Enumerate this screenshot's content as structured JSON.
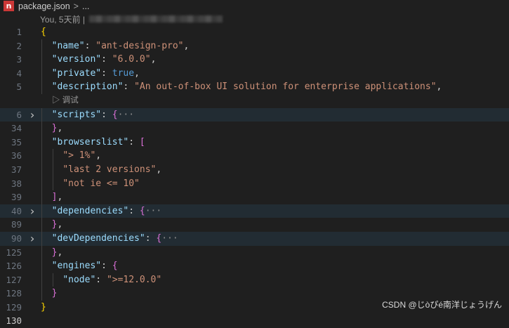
{
  "breadcrumb": {
    "icon": "npm-icon",
    "icon_letter": "n",
    "file": "package.json",
    "separator": ">",
    "more": "..."
  },
  "blame": {
    "text": "You, 5天前 |"
  },
  "codelens": {
    "label": "▷ 调试"
  },
  "lines": [
    {
      "n": "1",
      "tokens": [
        {
          "c": "b1",
          "t": "{"
        }
      ]
    },
    {
      "n": "2",
      "tokens": [
        {
          "c": "k",
          "t": "\"name\""
        },
        {
          "c": "p",
          "t": ": "
        },
        {
          "c": "s",
          "t": "\"ant-design-pro\""
        },
        {
          "c": "p",
          "t": ","
        }
      ]
    },
    {
      "n": "3",
      "tokens": [
        {
          "c": "k",
          "t": "\"version\""
        },
        {
          "c": "p",
          "t": ": "
        },
        {
          "c": "s",
          "t": "\"6.0.0\""
        },
        {
          "c": "p",
          "t": ","
        }
      ]
    },
    {
      "n": "4",
      "tokens": [
        {
          "c": "k",
          "t": "\"private\""
        },
        {
          "c": "p",
          "t": ": "
        },
        {
          "c": "kw",
          "t": "true"
        },
        {
          "c": "p",
          "t": ","
        }
      ]
    },
    {
      "n": "5",
      "tokens": [
        {
          "c": "k",
          "t": "\"description\""
        },
        {
          "c": "p",
          "t": ": "
        },
        {
          "c": "s",
          "t": "\"An out-of-box UI solution for enterprise applications\""
        },
        {
          "c": "p",
          "t": ","
        }
      ]
    },
    {
      "n": "",
      "codelens": true
    },
    {
      "n": "6",
      "fold": true,
      "hl": true,
      "tokens": [
        {
          "c": "k",
          "t": "\"scripts\""
        },
        {
          "c": "p",
          "t": ": "
        },
        {
          "c": "b2",
          "t": "{"
        },
        {
          "c": "dots",
          "t": "···"
        }
      ]
    },
    {
      "n": "34",
      "tokens": [
        {
          "c": "b2",
          "t": "}"
        },
        {
          "c": "p",
          "t": ","
        }
      ]
    },
    {
      "n": "35",
      "tokens": [
        {
          "c": "k",
          "t": "\"browserslist\""
        },
        {
          "c": "p",
          "t": ": "
        },
        {
          "c": "b2",
          "t": "["
        }
      ]
    },
    {
      "n": "36",
      "indent": 2,
      "tokens": [
        {
          "c": "s",
          "t": "\"> 1%\""
        },
        {
          "c": "p",
          "t": ","
        }
      ]
    },
    {
      "n": "37",
      "indent": 2,
      "tokens": [
        {
          "c": "s",
          "t": "\"last 2 versions\""
        },
        {
          "c": "p",
          "t": ","
        }
      ]
    },
    {
      "n": "38",
      "indent": 2,
      "tokens": [
        {
          "c": "s",
          "t": "\"not ie <= 10\""
        }
      ]
    },
    {
      "n": "39",
      "tokens": [
        {
          "c": "b2",
          "t": "]"
        },
        {
          "c": "p",
          "t": ","
        }
      ]
    },
    {
      "n": "40",
      "fold": true,
      "hl": true,
      "tokens": [
        {
          "c": "k",
          "t": "\"dependencies\""
        },
        {
          "c": "p",
          "t": ": "
        },
        {
          "c": "b2",
          "t": "{"
        },
        {
          "c": "dots",
          "t": "···"
        }
      ]
    },
    {
      "n": "89",
      "tokens": [
        {
          "c": "b2",
          "t": "}"
        },
        {
          "c": "p",
          "t": ","
        }
      ]
    },
    {
      "n": "90",
      "fold": true,
      "hl": true,
      "tokens": [
        {
          "c": "k",
          "t": "\"devDependencies\""
        },
        {
          "c": "p",
          "t": ": "
        },
        {
          "c": "b2",
          "t": "{"
        },
        {
          "c": "dots",
          "t": "···"
        }
      ]
    },
    {
      "n": "125",
      "tokens": [
        {
          "c": "b2",
          "t": "}"
        },
        {
          "c": "p",
          "t": ","
        }
      ]
    },
    {
      "n": "126",
      "tokens": [
        {
          "c": "k",
          "t": "\"engines\""
        },
        {
          "c": "p",
          "t": ": "
        },
        {
          "c": "b2",
          "t": "{"
        }
      ]
    },
    {
      "n": "127",
      "indent": 2,
      "tokens": [
        {
          "c": "k",
          "t": "\"node\""
        },
        {
          "c": "p",
          "t": ": "
        },
        {
          "c": "s",
          "t": "\">=12.0.0\""
        }
      ]
    },
    {
      "n": "128",
      "tokens": [
        {
          "c": "b2",
          "t": "}"
        }
      ]
    },
    {
      "n": "129",
      "indent": 0,
      "tokens": [
        {
          "c": "b1",
          "t": "}"
        }
      ]
    },
    {
      "n": "130",
      "current": true,
      "tokens": []
    }
  ],
  "watermark": "CSDN @じòぴé南洋じょうげん"
}
